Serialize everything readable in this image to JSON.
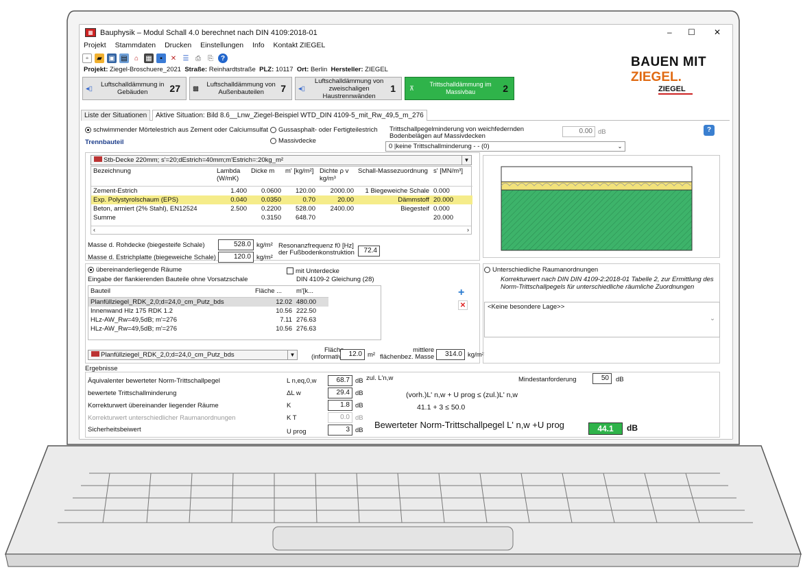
{
  "window": {
    "title": "Bauphysik – Modul Schall 4.0",
    "subtitle": "berechnet nach DIN 4109:2018-01",
    "min": "–",
    "max": "☐",
    "close": "✕"
  },
  "menu": [
    "Projekt",
    "Stammdaten",
    "Drucken",
    "Einstellungen",
    "Info",
    "Kontakt ZIEGEL"
  ],
  "project": {
    "projekt_label": "Projekt:",
    "projekt": "Ziegel-Broschuere_2021",
    "strasse_label": "Straße:",
    "strasse": "Reinhardtstraße",
    "plz_label": "PLZ:",
    "plz": "10117",
    "ort_label": "Ort:",
    "ort": "Berlin",
    "hersteller_label": "Hersteller:",
    "hersteller": "ZIEGEL"
  },
  "logo": {
    "line1": "BAUEN MIT",
    "line2": "ZIEGEL.",
    "line3": "ZIEGEL"
  },
  "modules": [
    {
      "label": "Luftschalldämmung in Gebäuden",
      "count": "27"
    },
    {
      "label": "Luftschalldämmung von Außenbauteilen",
      "count": "7"
    },
    {
      "label": "Luftschalldämmung von zweischaligen Haustrennwänden",
      "count": "1"
    },
    {
      "label": "Trittschalldämmung im Massivbau",
      "count": "2"
    }
  ],
  "tabs": {
    "list": "Liste der Situationen",
    "active": "Aktive Situation: Bild 8.6__Lnw_Ziegel-Beispiel WTD_DIN 4109-5_mit_Rw_49,5_m_276"
  },
  "estrich": {
    "opt1": "schwimmender Mörtelestrich aus Zement oder Calciumsulfat",
    "opt2": "Gussasphalt- oder Fertigteilestrich",
    "opt3": "Massivdecke",
    "trennbauteil": "Trennbauteil"
  },
  "minderung": {
    "label1": "Trittschallpegelminderung von weichfedernden",
    "label2": "Bodenbelägen auf Massivdecken",
    "value": "0.00",
    "unit": "dB",
    "combo": "0 |keine Trittschallminderung - - (0)"
  },
  "decke": {
    "combo": "Stb-Decke 220mm; s'=20;dEstrich=40mm;m'Estrich=:20kg_m²",
    "headers": [
      "Bezeichnung",
      "Lambda (W/mK)",
      "Dicke m",
      "m' [kg/m²]",
      "Dichte ρ v kg/m³",
      "Schall-Massezuordnung",
      "s' [MN/m³]"
    ],
    "rows": [
      [
        "Zement-Estrich",
        "1.400",
        "0.0600",
        "120.00",
        "2000.00",
        "1 Biegeweiche Schale",
        "0.000"
      ],
      [
        "Exp. Polystyrolschaum (EPS)",
        "0.040",
        "0.0350",
        "0.70",
        "20.00",
        "Dämmstoff",
        "20.000"
      ],
      [
        "Beton, armiert (2% Stahl), EN12524",
        "2.500",
        "0.2200",
        "528.00",
        "2400.00",
        "Biegesteif",
        "0.000"
      ],
      [
        "Summe",
        "",
        "0.3150",
        "648.70",
        "",
        "",
        "20.000"
      ]
    ]
  },
  "masse": {
    "rohdecke_label": "Masse d. Rohdecke   (biegesteife Schale)",
    "rohdecke": "528.0",
    "estrich_label": "Masse d. Estrichplatte (biegeweiche Schale)",
    "estrich": "120.0",
    "unit": "kg/m²",
    "res_label1": "Resonanzfrequenz f0 [Hz]",
    "res_label2": "der Fußbodenkonstruktion",
    "res": "72.4"
  },
  "raeume": {
    "opt1": "übereinanderliegende Räume",
    "eingabe": "Eingabe der flankierenden Bauteile ohne Vorsatzschale",
    "unterdecke": "mit Unterdecke",
    "din": "DIN 4109-2 Gleichung (28)",
    "headers": [
      "Bauteil",
      "Fläche ...",
      "m'[k..."
    ],
    "rows": [
      [
        "Planfüllziegel_RDK_2,0;d=24,0_cm_Putz_bds",
        "12.02",
        "480.00"
      ],
      [
        "Innenwand Hlz 175 RDK 1.2",
        "10.56",
        "222.50"
      ],
      [
        "HLz-AW_Rw=49,5dB; m'=276",
        "7.11",
        "276.63"
      ],
      [
        "HLz-AW_Rw=49,5dB; m'=276",
        "10.56",
        "276.63"
      ]
    ],
    "combo": "Planfüllziegel_RDK_2,0;d=24,0_cm_Putz_bds",
    "flaeche_label1": "Fläche",
    "flaeche_label2": "(informativ)",
    "flaeche": "12.0",
    "flaeche_unit": "m²",
    "masse_label1": "mittlere",
    "masse_label2": "flächenbez. Masse",
    "masse": "314.0",
    "masse_unit": "kg/m²"
  },
  "anordnung": {
    "opt": "Unterschiedliche Raumanordnungen",
    "text1": "Korrekturwert nach DIN DIN 4109-2:2018-01 Tabelle 2, zur Ermittlung des",
    "text2": "Norm-Trittschallpegels für unterschiedliche räumliche Zuordnungen",
    "combo": "<Keine besondere Lage>>"
  },
  "ergebnisse": {
    "title": "Ergebnisse",
    "rows": [
      {
        "label": "Äquivalenter bewerteter Norm-Trittschallpegel",
        "sym": "L n,eq,0,w",
        "value": "68.7",
        "unit": "dB"
      },
      {
        "label": "bewertete Trittschallminderung",
        "sym": "ΔL w",
        "value": "29.4",
        "unit": "dB"
      },
      {
        "label": "Korrekturwert übereinander liegender Räume",
        "sym": "K",
        "value": "1.8",
        "unit": "dB"
      },
      {
        "label": "Korrekturwert unterschiedlicher Raumanordnungen",
        "sym": "K T",
        "value": "0.0",
        "unit": "dB"
      },
      {
        "label": "Sicherheitsbeiwert",
        "sym": "U prog",
        "value": "3",
        "unit": "dB"
      }
    ],
    "zul": "zul. L'n,w",
    "mindest_label": "Mindestanforderung",
    "mindest": "50",
    "mindest_unit": "dB",
    "formel": "(vorh.)L' n,w  + U prog  ≤ (zul.)L' n,w",
    "werte": "41.1   +   3     ≤ 50.0",
    "result_label": "Bewerteter Norm-Trittschallpegel L' n,w +U prog",
    "result": "44.1",
    "result_unit": "dB"
  }
}
